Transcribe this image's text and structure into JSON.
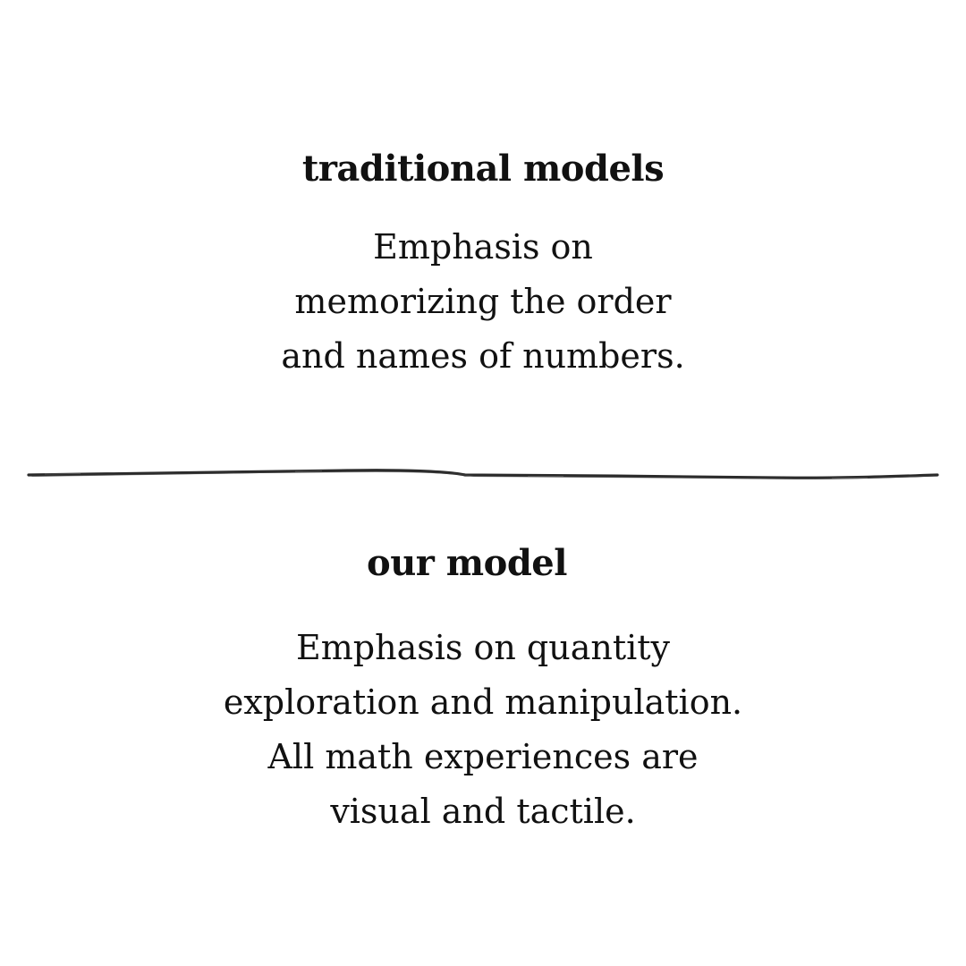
{
  "traditional": {
    "heading": "traditional models",
    "lines": [
      "Emphasis on",
      "memorizing the order",
      "and names of numbers."
    ]
  },
  "ours": {
    "heading": "our model",
    "lines": [
      "Emphasis on quantity",
      "exploration and manipulation.",
      "All math experiences are",
      "visual and tactile."
    ]
  },
  "colors": {
    "text": "#111111",
    "divider": "#2a2a2a",
    "background": "#ffffff"
  }
}
